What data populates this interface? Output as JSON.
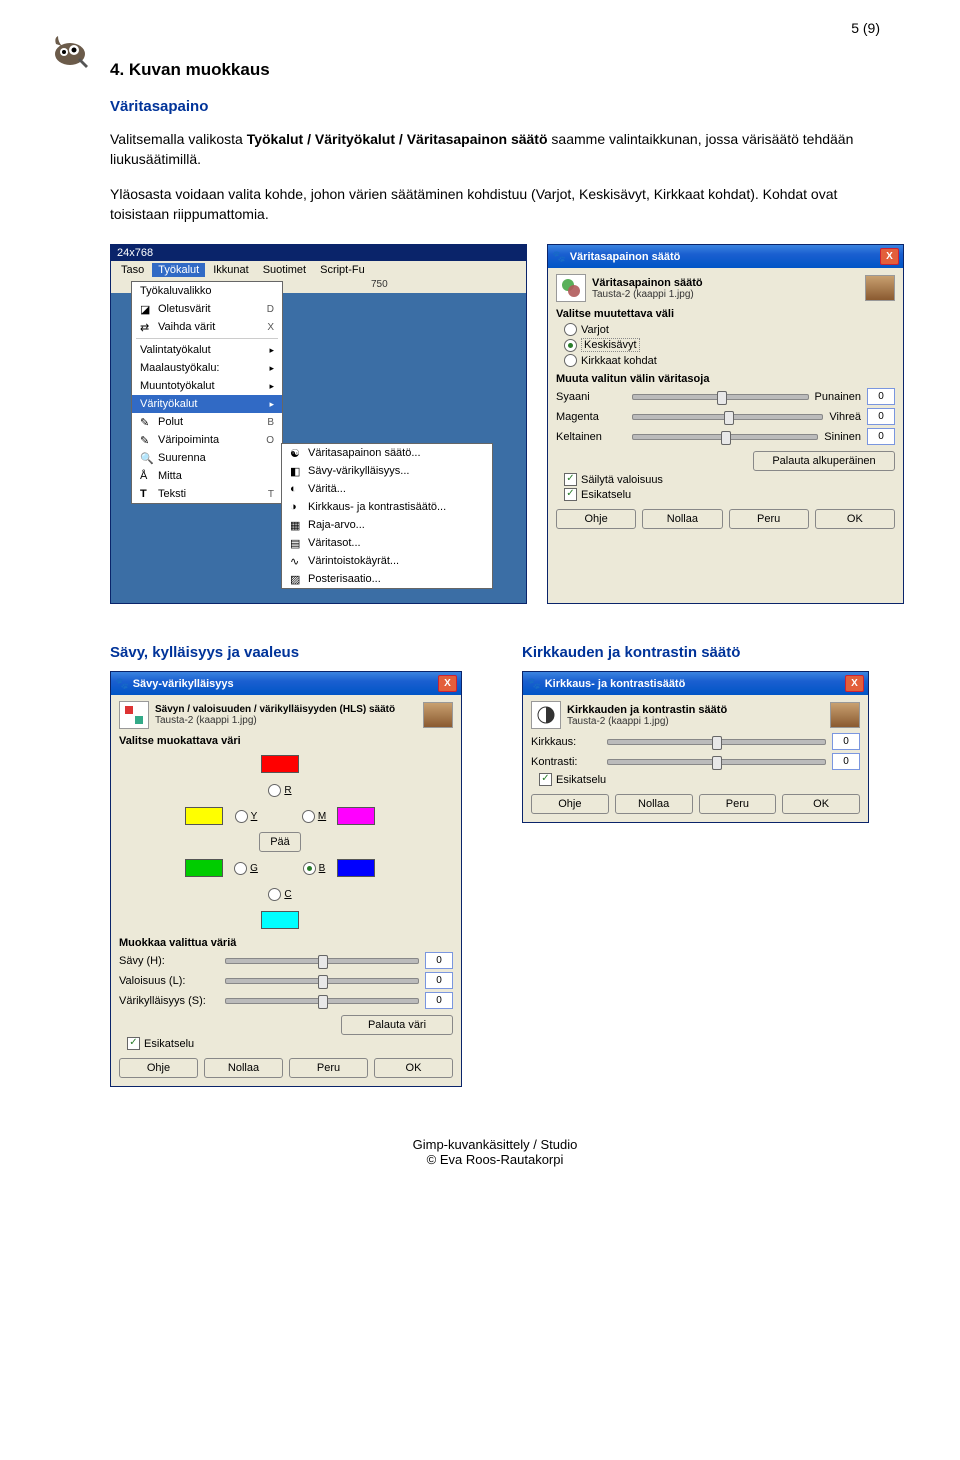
{
  "page_number": "5 (9)",
  "h_section": "4. Kuvan muokkaus",
  "h_sub1": "Väritasapaino",
  "para1_a": "Valitsemalla valikosta ",
  "para1_b": "Työkalut / Värityökalut / Väritasapainon säätö",
  "para1_c": " saamme valintaikkunan, jossa värisäätö tehdään liukusäätimillä.",
  "para2": "Yläosasta voidaan valita kohde, johon värien säätäminen kohdistuu (Varjot, Keskisävyt, Kirkkaat kohdat). Kohdat ovat toisistaan riippumattomia.",
  "h_sub2": "Sävy, kylläisyys ja vaaleus",
  "h_sub3": "Kirkkauden ja kontrastin säätö",
  "menu_shot": {
    "doc_title": "24x768",
    "ruler_mark": "750",
    "menubar": [
      "Taso",
      "Työkalut",
      "Ikkunat",
      "Suotimet",
      "Script-Fu"
    ],
    "drop": [
      {
        "t": "Työkaluvalikko"
      },
      {
        "t": "Oletusvärit",
        "k": "D"
      },
      {
        "t": "Vaihda värit",
        "k": "X"
      },
      {
        "sep": true
      },
      {
        "t": "Valintatyökalut",
        "sub": true
      },
      {
        "t": "Maalaustyökalu:",
        "sub": true
      },
      {
        "t": "Muuntotyökalut",
        "sub": true
      },
      {
        "t": "Värityökalut",
        "hi": true,
        "sub": true
      },
      {
        "t": "Polut",
        "k": "B"
      },
      {
        "t": "Väripoiminta",
        "k": "O"
      },
      {
        "t": "Suurenna"
      },
      {
        "t": "Mitta"
      },
      {
        "t": "Teksti",
        "k": "T"
      }
    ],
    "submenu": [
      "Väritasapainon säätö...",
      "Sävy-värikylläisyys...",
      "Väritä...",
      "Kirkkaus- ja kontrastisäätö...",
      "Raja-arvo...",
      "Väritasot...",
      "Värintoistokäyrät...",
      "Posterisaatio..."
    ]
  },
  "dlg_cb": {
    "title": "Väritasapainon säätö",
    "preset_title": "Väritasapainon säätö",
    "preset_sub": "Tausta-2 (kaappi 1.jpg)",
    "grp1": "Valitse muutettava väli",
    "r1": "Varjot",
    "r2": "Keskisävyt",
    "r3": "Kirkkaat kohdat",
    "grp2": "Muuta valitun välin väritasoja",
    "s1l": "Syaani",
    "s1r": "Punainen",
    "s1v": "0",
    "s2l": "Magenta",
    "s2r": "Vihreä",
    "s2v": "0",
    "s3l": "Keltainen",
    "s3r": "Sininen",
    "s3v": "0",
    "reset": "Palauta alkuperäinen",
    "c1": "Säilytä valoisuus",
    "c2": "Esikatselu",
    "b1": "Ohje",
    "b2": "Nollaa",
    "b3": "Peru",
    "b4": "OK"
  },
  "dlg_hls": {
    "title": "Sävy-värikylläisyys",
    "preset_title": "Sävyn / valoisuuden / värikylläisyyden (HLS) säätö",
    "preset_sub": "Tausta-2 (kaappi 1.jpg)",
    "grp1": "Valitse muokattava väri",
    "paa": "Pää",
    "labels": {
      "R": "R",
      "Y": "Y",
      "M": "M",
      "G": "G",
      "B": "B",
      "C": "C"
    },
    "grp2": "Muokkaa valittua väriä",
    "s1": "Sävy (H):",
    "s1v": "0",
    "s2": "Valoisuus (L):",
    "s2v": "0",
    "s3": "Värikylläisyys (S):",
    "s3v": "0",
    "reset": "Palauta väri",
    "c1": "Esikatselu",
    "b1": "Ohje",
    "b2": "Nollaa",
    "b3": "Peru",
    "b4": "OK"
  },
  "dlg_bc": {
    "title": "Kirkkaus- ja kontrastisäätö",
    "preset_title": "Kirkkauden ja kontrastin säätö",
    "preset_sub": "Tausta-2 (kaappi 1.jpg)",
    "s1": "Kirkkaus:",
    "s1v": "0",
    "s2": "Kontrasti:",
    "s2v": "0",
    "c1": "Esikatselu",
    "b1": "Ohje",
    "b2": "Nollaa",
    "b3": "Peru",
    "b4": "OK"
  },
  "footer1": "Gimp-kuvankäsittely / Studio",
  "footer2": "© Eva Roos-Rautakorpi"
}
